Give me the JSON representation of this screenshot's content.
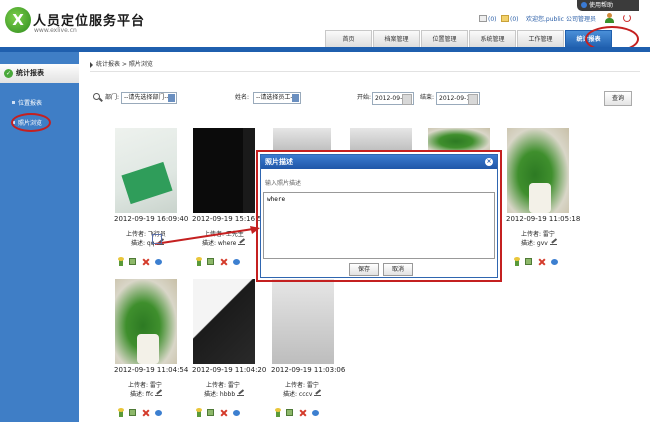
{
  "header": {
    "app_title": "人员定位服务平台",
    "app_subtitle": "www.exlive.cn",
    "help_label": "使用帮助",
    "msg_count": "(0)",
    "mail_count": "(0)",
    "welcome": "欢迎您,public",
    "role": "公司管理员"
  },
  "nav": {
    "tabs": [
      "首页",
      "档案管理",
      "位置管理",
      "系统管理",
      "工作管理",
      "统计报表"
    ],
    "active": "统计报表"
  },
  "sidebar": {
    "title": "统计报表",
    "items": [
      "位置报表",
      "照片浏览"
    ]
  },
  "breadcrumb": "统计报表 > 照片浏览",
  "filters": {
    "dept_label": "部门:",
    "dept_value": "--请先选择部门--",
    "name_label": "姓名:",
    "name_value": "--请选择员工--",
    "start_label": "开始:",
    "start_value": "2012-09-17",
    "end_label": "结束:",
    "end_value": "2012-09-19",
    "query_label": "查询"
  },
  "photos": [
    {
      "time": "2012-09-19 16:09:40",
      "uploader": "上传者: 飞行员",
      "desc": "描述: qq"
    },
    {
      "time": "2012-09-19 15:16:58",
      "uploader": "上传者: 王先生",
      "desc": "描述: where"
    },
    {
      "time": "2012-09-19 11:05:18",
      "uploader": "上传者: 雷宁",
      "desc": "描述: gvv"
    },
    {
      "time": "2012-09-19 11:04:54",
      "uploader": "上传者: 雷宁",
      "desc": "描述: ffc"
    },
    {
      "time": "2012-09-19 11:04:20",
      "uploader": "上传者: 雷宁",
      "desc": "描述: hbbb"
    },
    {
      "time": "2012-09-19 11:03:06",
      "uploader": "上传者: 雷宁",
      "desc": "描述: cccv"
    }
  ],
  "dialog": {
    "title": "照片描述",
    "prompt": "输入照片描述",
    "text": "where",
    "save_label": "保存",
    "cancel_label": "取消"
  },
  "colors": {
    "brand_blue": "#1f5fae",
    "sidebar": "#3f7ec6",
    "highlight_ring": "#c42020"
  }
}
